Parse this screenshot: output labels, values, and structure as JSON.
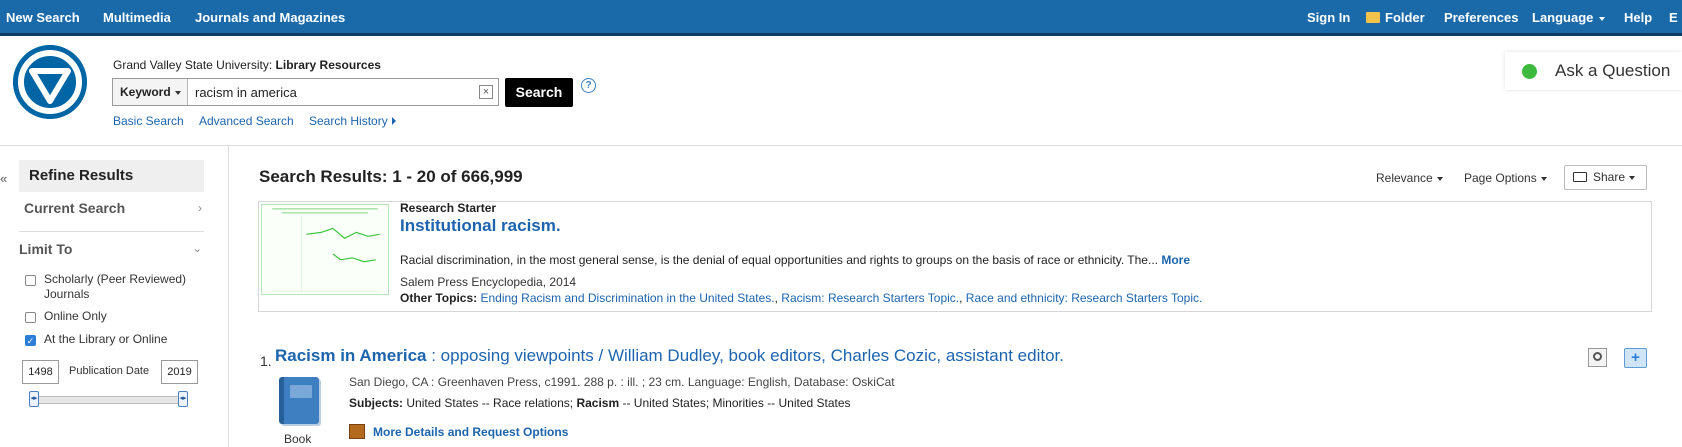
{
  "topnav": {
    "left": [
      "New Search",
      "Multimedia",
      "Journals and Magazines"
    ],
    "sign_in": "Sign In",
    "folder": "Folder",
    "preferences": "Preferences",
    "language": "Language",
    "help": "Help",
    "exit_partial": "E"
  },
  "header": {
    "institution": "Grand Valley State University:",
    "institution_bold": "Library Resources",
    "field_select": "Keyword",
    "query": "racism in america",
    "search_button": "Search",
    "help_icon": "?",
    "links": [
      "Basic Search",
      "Advanced Search",
      "Search History"
    ],
    "ask_question": "Ask a Question",
    "ask_status_color": "#3db93d"
  },
  "sidebar": {
    "collapse_glyph": "«",
    "refine_title": "Refine Results",
    "current_search": "Current Search",
    "limit_to": "Limit To",
    "limits": [
      {
        "label": "Scholarly (Peer Reviewed) Journals",
        "checked": false
      },
      {
        "label": "Online Only",
        "checked": false
      },
      {
        "label": "At the Library or Online",
        "checked": true
      }
    ],
    "pub_date_label": "Publication Date",
    "year_from": "1498",
    "year_to": "2019"
  },
  "results": {
    "summary": "Search Results: 1 - 20 of 666,999",
    "controls": {
      "sort": "Relevance",
      "page_options": "Page Options",
      "share": "Share"
    },
    "research_starter": {
      "label": "Research Starter",
      "title": "Institutional racism.",
      "description": "Racial discrimination, in the most general sense, is the denial of equal opportunities and rights to groups on the basis of race or ethnicity. The...",
      "more": "More",
      "source": "Salem Press Encyclopedia, 2014",
      "other_topics_label": "Other Topics:",
      "topics": [
        "Ending Racism and Discrimination in the United States.",
        "Racism: Research Starters Topic.",
        "Race and ethnicity: Research Starters Topic."
      ]
    },
    "items": [
      {
        "number": "1.",
        "title_bold": "Racism in America",
        "title_rest": " : opposing viewpoints / William Dudley, book editors, Charles Cozic, assistant editor.",
        "meta": "San Diego, CA : Greenhaven Press, c1991. 288 p. : ill. ; 23 cm. Language: English, Database: OskiCat",
        "subjects_label": "Subjects:",
        "subjects_1": " United States -- Race relations; ",
        "subjects_bold": "Racism",
        "subjects_2": " -- United States; Minorities -- United States",
        "format": "Book",
        "details_link": "More Details and Request Options"
      }
    ]
  },
  "colors": {
    "topbar": "#1a6aaa",
    "link": "#1d64ae",
    "search_button": "#000000"
  }
}
